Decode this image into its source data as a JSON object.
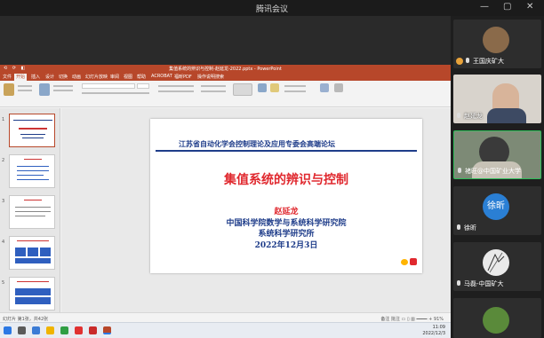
{
  "window": {
    "title": "腾讯会议"
  },
  "ppt": {
    "title": "集值系统的辨识与控制-赵延龙-2022.pptx - PowerPoint",
    "quick_access": "⟲ ⟳ ◧",
    "tabs": [
      "文件",
      "开始",
      "插入",
      "设计",
      "切换",
      "动画",
      "幻灯片放映",
      "审阅",
      "视图",
      "帮助",
      "ACROBAT",
      "福昕PDF",
      "操作说明搜索"
    ],
    "slide_count_label": "幻灯片 第1张，共42张",
    "status_right": "备注  批注  ▭  ▯  ▥  ━━━━  +  91%",
    "slide": {
      "header": "江苏省自动化学会控制理论及应用专委会高端论坛",
      "title": "集值系统的辨识与控制",
      "author": "赵延龙",
      "org1": "中国科学院数学与系统科学研究院",
      "org2": "系统科学研究所",
      "date": "2022年12月3日"
    },
    "thumb_numbers": [
      "1",
      "2",
      "3",
      "4",
      "5"
    ]
  },
  "taskbar": {
    "time": "11:09",
    "date": "2022/12/3"
  },
  "participants": [
    {
      "name": "王国庆矿大",
      "mic_on": true,
      "has_video": false,
      "avatar_color": "#8a6a4a"
    },
    {
      "name": "赵延龙",
      "mic_on": true,
      "has_video": true,
      "avatar_color": "#c9c2b8"
    },
    {
      "name": "褚旺@中国矿业大学",
      "mic_on": true,
      "has_video": true,
      "avatar_color": "#6e7f6a",
      "active": true
    },
    {
      "name": "徐昕",
      "mic_on": true,
      "has_video": false,
      "avatar_color": "#2a7fd4",
      "initials": "徐昕"
    },
    {
      "name": "马磊-中国矿大",
      "mic_on": true,
      "has_video": false,
      "avatar_color": "#e9e9e9"
    },
    {
      "name": "",
      "mic_on": true,
      "has_video": false,
      "avatar_color": "#5a8a3a"
    }
  ]
}
